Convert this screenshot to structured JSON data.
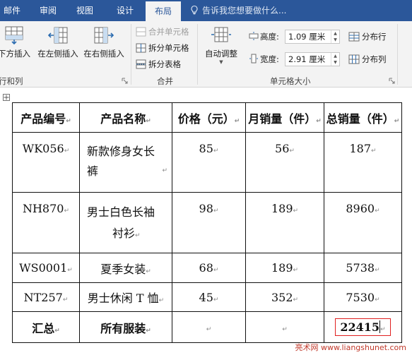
{
  "tabs": [
    {
      "label": "邮件"
    },
    {
      "label": "审阅"
    },
    {
      "label": "视图"
    },
    {
      "label": "设计"
    },
    {
      "label": "布局",
      "active": true
    }
  ],
  "tell_me": "告诉我您想要做什么...",
  "ribbon": {
    "rows_cols": {
      "insert_below": "下方插入",
      "insert_left": "在左侧插入",
      "insert_right": "在右侧插入",
      "group_label": "行和列"
    },
    "merge": {
      "merge_cells": "合并单元格",
      "split_cells": "拆分单元格",
      "split_table": "拆分表格",
      "group_label": "合并"
    },
    "cell_size": {
      "autofit": "自动调整",
      "height_label": "高度:",
      "height_value": "1.09 厘米",
      "width_label": "宽度:",
      "width_value": "2.91 厘米",
      "distribute_rows": "分布行",
      "distribute_cols": "分布列",
      "group_label": "单元格大小"
    }
  },
  "table": {
    "headers": [
      "产品编号",
      "产品名称",
      "价格（元）",
      "月销量（件）",
      "总销量（件）"
    ],
    "rows": [
      {
        "id": "WK056",
        "name_line1": "新款修身女长",
        "name_line2": "裤",
        "price": "85",
        "monthly": "56",
        "total": "187"
      },
      {
        "id": "NH870",
        "name_line1": "男士白色长袖",
        "name_line2": "衬衫",
        "price": "98",
        "monthly": "189",
        "total": "8960"
      },
      {
        "id": "WS0001",
        "name_line1": "夏季女装",
        "name_line2": "",
        "price": "68",
        "monthly": "189",
        "total": "5738"
      },
      {
        "id": "NT257",
        "name_line1": "男士休闲 T 恤",
        "name_line2": "",
        "price": "45",
        "monthly": "352",
        "total": "7530"
      }
    ],
    "summary": {
      "label": "汇总",
      "name": "所有服装",
      "total": "22415"
    },
    "para_mark": "↵"
  },
  "watermark": "亮术网 www.liangshunet.com",
  "colors": {
    "ribbon_tab_bar": "#2b579a",
    "ribbon_body": "#f3f3f3",
    "highlight_box": "#e02020"
  }
}
